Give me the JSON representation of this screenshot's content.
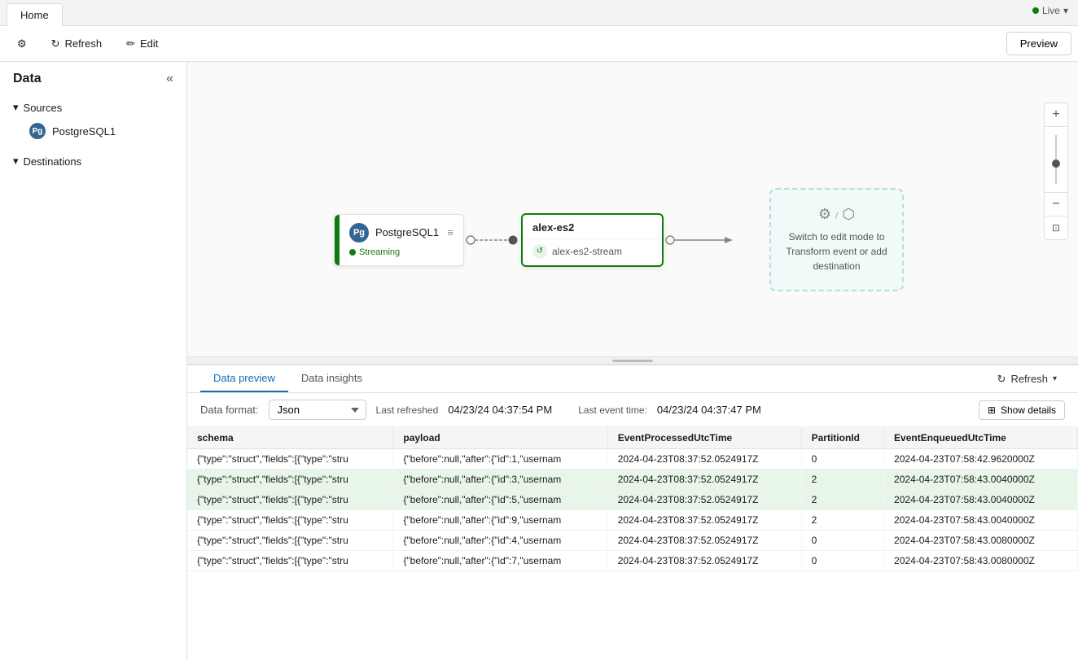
{
  "tab_bar": {
    "tab_label": "Home",
    "live_label": "Live"
  },
  "toolbar": {
    "refresh_label": "Refresh",
    "edit_label": "Edit",
    "preview_label": "Preview"
  },
  "sidebar": {
    "title": "Data",
    "sources_label": "Sources",
    "sources_item": "PostgreSQL1",
    "destinations_label": "Destinations"
  },
  "pipeline": {
    "postgres_node": {
      "title": "PostgreSQL1",
      "status": "Streaming"
    },
    "es2_node": {
      "title": "alex-es2",
      "stream_label": "alex-es2-stream"
    },
    "hint": {
      "text": "Switch to edit mode to Transform event or add destination"
    }
  },
  "bottom_panel": {
    "tab_preview": "Data preview",
    "tab_insights": "Data insights",
    "refresh_label": "Refresh",
    "format_label": "Data format:",
    "format_value": "Json",
    "last_refreshed_label": "Last refreshed",
    "last_refreshed_value": "04/23/24 04:37:54 PM",
    "last_event_label": "Last event time:",
    "last_event_value": "04/23/24 04:37:47 PM",
    "show_details_label": "Show details",
    "columns": [
      "schema",
      "payload",
      "EventProcessedUtcTime",
      "PartitionId",
      "EventEnqueuedUtcTime"
    ],
    "rows": [
      {
        "schema": "{\"type\":\"struct\",\"fields\":[{\"type\":\"stru",
        "payload": "{\"before\":null,\"after\":{\"id\":1,\"usernam",
        "event_time": "2024-04-23T08:37:52.0524917Z",
        "partition_id": "0",
        "enqueued_time": "2024-04-23T07:58:42.9620000Z"
      },
      {
        "schema": "{\"type\":\"struct\",\"fields\":[{\"type\":\"stru",
        "payload": "{\"before\":null,\"after\":{\"id\":3,\"usernam",
        "event_time": "2024-04-23T08:37:52.0524917Z",
        "partition_id": "2",
        "enqueued_time": "2024-04-23T07:58:43.0040000Z"
      },
      {
        "schema": "{\"type\":\"struct\",\"fields\":[{\"type\":\"stru",
        "payload": "{\"before\":null,\"after\":{\"id\":5,\"usernam",
        "event_time": "2024-04-23T08:37:52.0524917Z",
        "partition_id": "2",
        "enqueued_time": "2024-04-23T07:58:43.0040000Z"
      },
      {
        "schema": "{\"type\":\"struct\",\"fields\":[{\"type\":\"stru",
        "payload": "{\"before\":null,\"after\":{\"id\":9,\"usernam",
        "event_time": "2024-04-23T08:37:52.0524917Z",
        "partition_id": "2",
        "enqueued_time": "2024-04-23T07:58:43.0040000Z"
      },
      {
        "schema": "{\"type\":\"struct\",\"fields\":[{\"type\":\"stru",
        "payload": "{\"before\":null,\"after\":{\"id\":4,\"usernam",
        "event_time": "2024-04-23T08:37:52.0524917Z",
        "partition_id": "0",
        "enqueued_time": "2024-04-23T07:58:43.0080000Z"
      },
      {
        "schema": "{\"type\":\"struct\",\"fields\":[{\"type\":\"stru",
        "payload": "{\"before\":null,\"after\":{\"id\":7,\"usernam",
        "event_time": "2024-04-23T08:37:52.0524917Z",
        "partition_id": "0",
        "enqueued_time": "2024-04-23T07:58:43.0080000Z"
      }
    ]
  }
}
